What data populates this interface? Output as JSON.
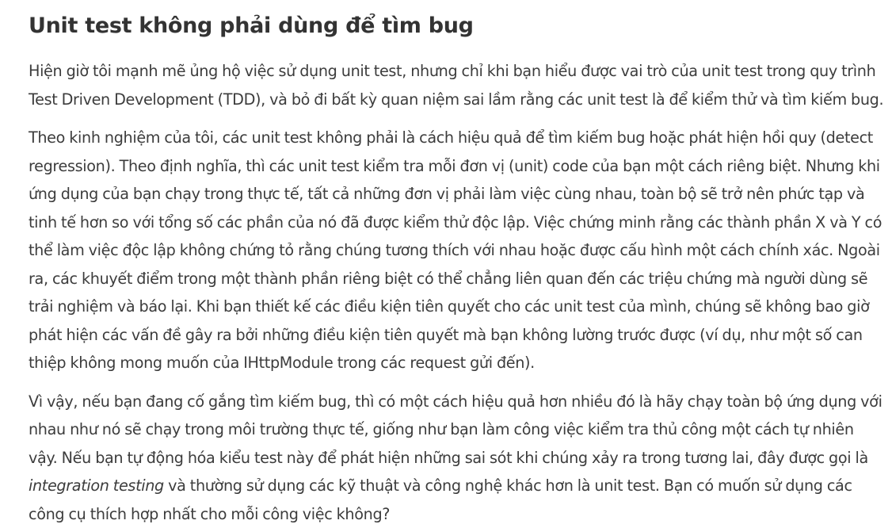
{
  "article": {
    "title": "Unit test không phải dùng để tìm bug",
    "paragraphs": [
      "Hiện giờ tôi mạnh mẽ ủng hộ việc sử dụng unit test, nhưng chỉ khi bạn hiểu được vai trò của unit test trong quy trình Test Driven Development (TDD), và bỏ đi bất kỳ quan niệm sai lầm rằng các unit test là để kiểm thử và tìm kiếm bug.",
      "Theo kinh nghiệm của tôi, các unit test không phải là cách hiệu quả để tìm kiếm bug hoặc phát hiện hồi quy (detect regression). Theo định nghĩa, thì các unit test kiểm tra mỗi đơn vị (unit) code của bạn một cách riêng biệt. Nhưng khi ứng dụng của bạn chạy trong thực tế, tất cả những đơn vị phải làm việc cùng nhau, toàn bộ sẽ trở nên phức tạp và tinh tế hơn so với tổng số các phần của nó đã được kiểm thử độc lập. Việc chứng minh rằng các thành phần X và Y có thể làm việc độc lập không chứng tỏ rằng chúng tương thích với nhau hoặc được cấu hình một cách chính xác. Ngoài ra, các khuyết điểm trong một thành phần riêng biệt có thể chẳng liên quan đến các triệu chứng mà người dùng sẽ trải nghiệm và báo lại. Khi bạn thiết kế các điều kiện tiên quyết cho các unit test của mình, chúng sẽ không bao giờ phát hiện các vấn đề gây ra bởi những điều kiện tiên quyết mà bạn không lường trước được (ví dụ, như một số can thiệp không mong muốn của IHttpModule trong các request gửi đến)."
    ],
    "paragraph3": {
      "before": "Vì vậy, nếu bạn đang cố gắng tìm kiếm bug, thì có một cách hiệu quả hơn nhiều đó là hãy chạy toàn bộ ứng dụng với nhau như nó sẽ chạy trong môi trường thực tế, giống như bạn làm công việc kiểm tra thủ công một cách tự nhiên vậy. Nếu bạn tự động hóa kiểu test này để phát hiện những sai sót khi chúng xảy ra trong tương lai, đây được gọi là ",
      "emphasis": "integration testing",
      "after": " và thường sử dụng các kỹ thuật và công nghệ khác hơn là unit test. Bạn có muốn sử dụng các công cụ thích hợp nhất cho mỗi công việc không?"
    }
  }
}
